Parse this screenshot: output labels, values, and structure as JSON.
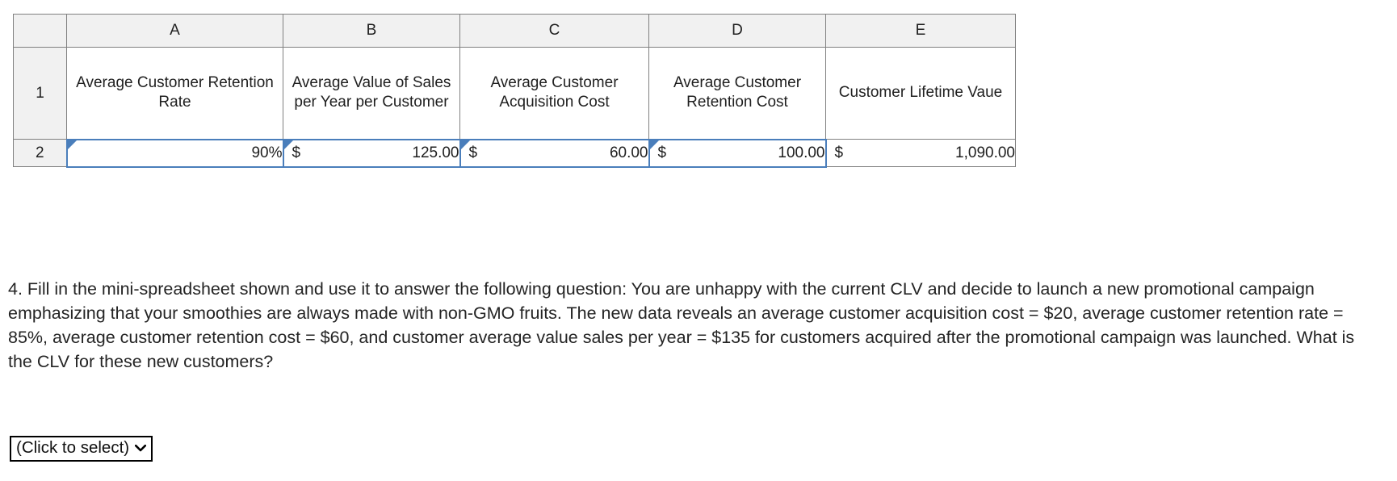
{
  "spreadsheet": {
    "column_headers": [
      "A",
      "B",
      "C",
      "D",
      "E"
    ],
    "row_numbers": [
      "1",
      "2"
    ],
    "row1_labels": [
      "Average Customer Retention Rate",
      "Average Value of Sales per Year per Customer",
      "Average Customer Acquisition Cost",
      "Average Customer Retention Cost",
      "Customer Lifetime Vaue"
    ],
    "row2_values": [
      {
        "currency": "",
        "value": "90%"
      },
      {
        "currency": "$",
        "value": "125.00"
      },
      {
        "currency": "$",
        "value": "60.00"
      },
      {
        "currency": "$",
        "value": "100.00"
      },
      {
        "currency": "$",
        "value": "1,090.00"
      }
    ],
    "selected_border_color": "#4a7ebb",
    "header_fill_color": "#f1f1f1",
    "grid_line_color": "#808080"
  },
  "question": {
    "text": "4. Fill in the mini-spreadsheet shown and use it to answer the following question: You are unhappy with the current CLV and decide to launch a new promotional campaign emphasizing that your smoothies are always made with non-GMO fruits. The new data reveals an average customer acquisition cost = $20, average customer retention rate = 85%, average customer retention cost = $60, and customer average value sales per year = $135 for customers acquired after the promotional campaign was launched. What is the CLV for these new customers?"
  },
  "answer_select": {
    "label": "(Click to select)",
    "icon": "chevron-down-icon"
  }
}
